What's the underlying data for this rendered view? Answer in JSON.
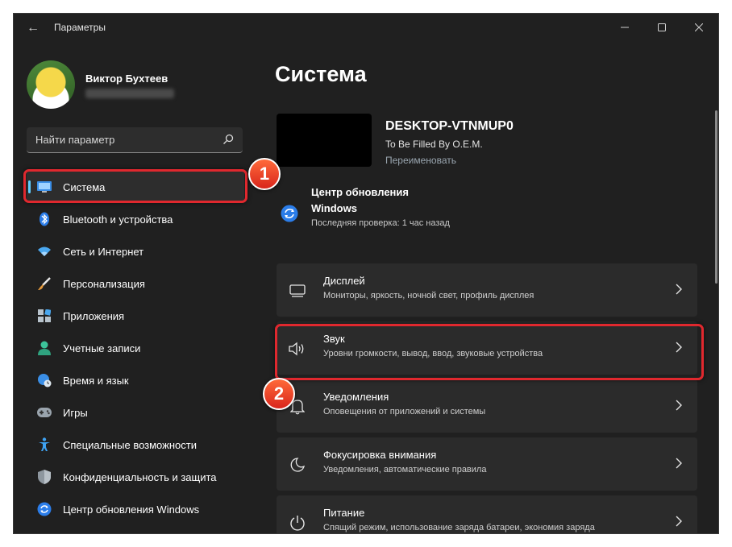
{
  "window": {
    "title": "Параметры",
    "controls": [
      "minimize-icon",
      "maximize-icon",
      "close-icon"
    ]
  },
  "user": {
    "name": "Виктор Бухтеев"
  },
  "search": {
    "placeholder": "Найти параметр"
  },
  "nav": [
    {
      "label": "Система",
      "icon": "system-icon",
      "active": true
    },
    {
      "label": "Bluetooth и устройства",
      "icon": "bluetooth-icon"
    },
    {
      "label": "Сеть и Интернет",
      "icon": "wifi-icon"
    },
    {
      "label": "Персонализация",
      "icon": "brush-icon"
    },
    {
      "label": "Приложения",
      "icon": "apps-icon"
    },
    {
      "label": "Учетные записи",
      "icon": "account-icon"
    },
    {
      "label": "Время и язык",
      "icon": "globe-clock-icon"
    },
    {
      "label": "Игры",
      "icon": "gamepad-icon"
    },
    {
      "label": "Специальные возможности",
      "icon": "accessibility-icon"
    },
    {
      "label": "Конфиденциальность и защита",
      "icon": "shield-icon"
    },
    {
      "label": "Центр обновления Windows",
      "icon": "windows-update-icon"
    }
  ],
  "main": {
    "title": "Система",
    "device": {
      "name": "DESKTOP-VTNMUP0",
      "model": "To Be Filled By O.E.M.",
      "rename": "Переименовать"
    },
    "update": {
      "title": "Центр обновления Windows",
      "subtitle": "Последняя проверка: 1 час назад"
    },
    "cards": [
      {
        "title": "Дисплей",
        "subtitle": "Мониторы, яркость, ночной свет, профиль дисплея",
        "icon": "monitor-icon"
      },
      {
        "title": "Звук",
        "subtitle": "Уровни громкости, вывод, ввод, звуковые устройства",
        "icon": "speaker-icon"
      },
      {
        "title": "Уведомления",
        "subtitle": "Оповещения от приложений и системы",
        "icon": "bell-icon"
      },
      {
        "title": "Фокусировка внимания",
        "subtitle": "Уведомления, автоматические правила",
        "icon": "moon-icon"
      },
      {
        "title": "Питание",
        "subtitle": "Спящий режим, использование заряда батареи, экономия заряда",
        "icon": "power-icon"
      }
    ]
  },
  "annotations": {
    "badge1": "1",
    "badge2": "2",
    "highlight_color": "#e0282e"
  },
  "colors": {
    "accent": "#60cdff",
    "background": "#202020",
    "card": "#2b2b2b"
  }
}
